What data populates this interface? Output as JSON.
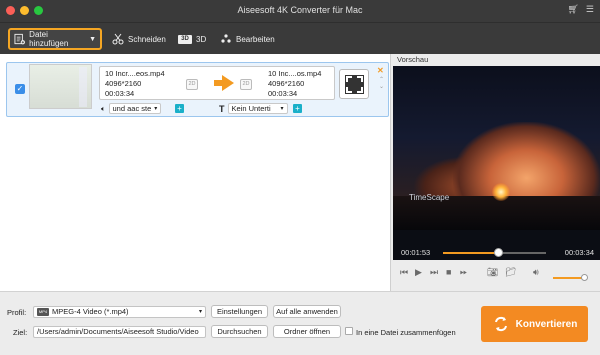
{
  "window": {
    "title": "Aiseesoft 4K Converter für Mac"
  },
  "toolbar": {
    "add_file": "Datei hinzufügen",
    "cut": "Schneiden",
    "three_d": "3D",
    "edit": "Bearbeiten",
    "three_d_badge": "3D"
  },
  "item": {
    "source_name": "10 Incr....eos.mp4",
    "source_resolution": "4096*2160",
    "source_duration": "00:03:34",
    "output_name": "10 Inc....os.mp4",
    "output_resolution": "4096*2160",
    "output_duration": "00:03:34",
    "badge": "2D",
    "audio_track": "und aac ste",
    "subtitle": "Kein Unterti",
    "checked": true
  },
  "preview": {
    "label": "Vorschau",
    "watermark": "TimeScape",
    "time_current": "00:01:53",
    "time_total": "00:03:34",
    "progress_fraction": 0.53,
    "volume_fraction": 0.9
  },
  "bottom": {
    "profile_label": "Profil:",
    "profile_value": "MPEG-4 Video (*.mp4)",
    "settings_button": "Einstellungen",
    "apply_all_button": "Auf alle anwenden",
    "target_label": "Ziel:",
    "target_value": "/Users/admin/Documents/Aiseesoft Studio/Video",
    "browse_button": "Durchsuchen",
    "open_folder_button": "Ordner öffnen",
    "merge_label": "In eine Datei zusammenfügen",
    "convert_button": "Konvertieren"
  },
  "colors": {
    "accent": "#f38a22",
    "selection": "#eaf3fc",
    "toolbar": "#3a3a3a"
  }
}
